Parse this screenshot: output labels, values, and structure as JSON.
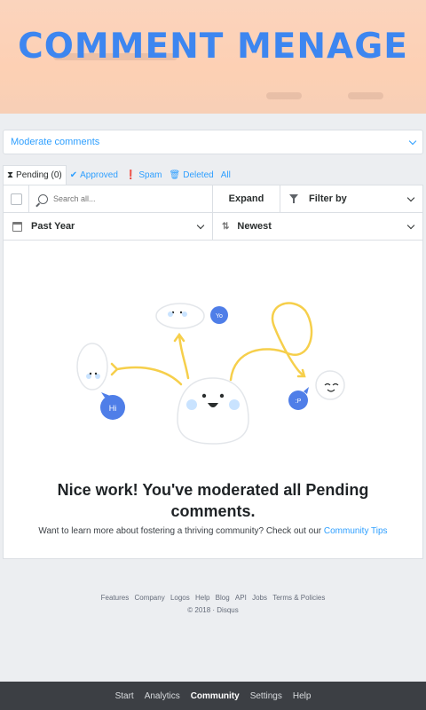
{
  "hero": {
    "title": "COMMENT MENAGE"
  },
  "moderate_select": {
    "label": "Moderate comments"
  },
  "tabs": [
    {
      "label": "Pending (0)",
      "icon": "hourglass-icon"
    },
    {
      "label": "Approved",
      "icon": "check-icon"
    },
    {
      "label": "Spam",
      "icon": "alert-icon"
    },
    {
      "label": "Deleted",
      "icon": "trash-icon"
    },
    {
      "label": "All",
      "icon": ""
    }
  ],
  "toolbar": {
    "search_placeholder": "Search all...",
    "expand_label": "Expand",
    "filter_label": "Filter by",
    "period_label": "Past Year",
    "sort_label": "Newest"
  },
  "illustration": {
    "bubble_hi": "Hi",
    "bubble_yo": "Yo",
    "bubble_p": ":P"
  },
  "empty_state": {
    "title_line1": "Nice work! You've moderated all Pending",
    "title_line2": "comments.",
    "subtitle": "Want to learn more about fostering a thriving community? Check out our",
    "link": "Community Tips"
  },
  "footer": {
    "links": [
      "Features",
      "Company",
      "Logos",
      "Help",
      "Blog",
      "API",
      "Jobs",
      "Terms & Policies"
    ],
    "copyright": "© 2018 · Disqus"
  },
  "bottom_nav": [
    "Start",
    "Analytics",
    "Community",
    "Settings",
    "Help"
  ],
  "colors": {
    "accent": "#2e9fff",
    "hero_title": "#3d86f0",
    "nav_bg": "#3c3f44",
    "illus_yellow": "#f6cf4b"
  }
}
